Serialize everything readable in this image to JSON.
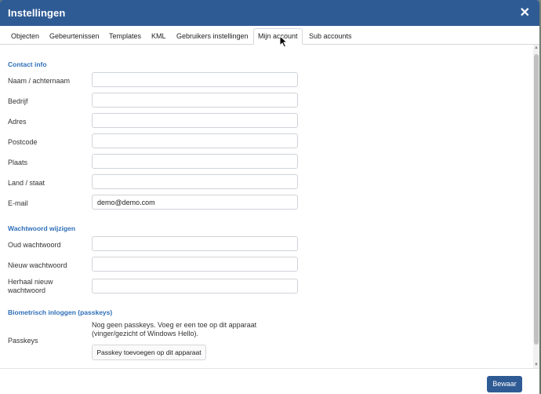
{
  "dialog": {
    "title": "Instellingen",
    "close_icon": "close-icon"
  },
  "tabs": [
    {
      "label": "Objecten"
    },
    {
      "label": "Gebeurtenissen"
    },
    {
      "label": "Templates"
    },
    {
      "label": "KML"
    },
    {
      "label": "Gebruikers instellingen"
    },
    {
      "label": "Mijn account",
      "active": true
    },
    {
      "label": "Sub accounts"
    }
  ],
  "contact": {
    "heading": "Contact info",
    "fields": [
      {
        "label": "Naam / achternaam",
        "value": ""
      },
      {
        "label": "Bedrijf",
        "value": ""
      },
      {
        "label": "Adres",
        "value": ""
      },
      {
        "label": "Postcode",
        "value": ""
      },
      {
        "label": "Plaats",
        "value": ""
      },
      {
        "label": "Land / staat",
        "value": ""
      },
      {
        "label": "E-mail",
        "value": "demo@demo.com"
      }
    ]
  },
  "password": {
    "heading": "Wachtwoord wijzigen",
    "fields": [
      {
        "label": "Oud wachtwoord",
        "value": ""
      },
      {
        "label": "Nieuw wachtwoord",
        "value": ""
      },
      {
        "label": "Herhaal nieuw wachtwoord",
        "value": ""
      }
    ]
  },
  "biometric": {
    "heading": "Biometrisch inloggen (passkeys)",
    "label": "Passkeys",
    "note": "Nog geen passkeys. Voeg er een toe op dit apparaat (vinger/gezicht of Windows Hello).",
    "button": "Passkey toevoegen op dit apparaat"
  },
  "footer": {
    "save_label": "Bewaar"
  },
  "colors": {
    "titlebar": "#2f5b95",
    "section_heading": "#2f6fb8",
    "save_button": "#2f5b95"
  }
}
